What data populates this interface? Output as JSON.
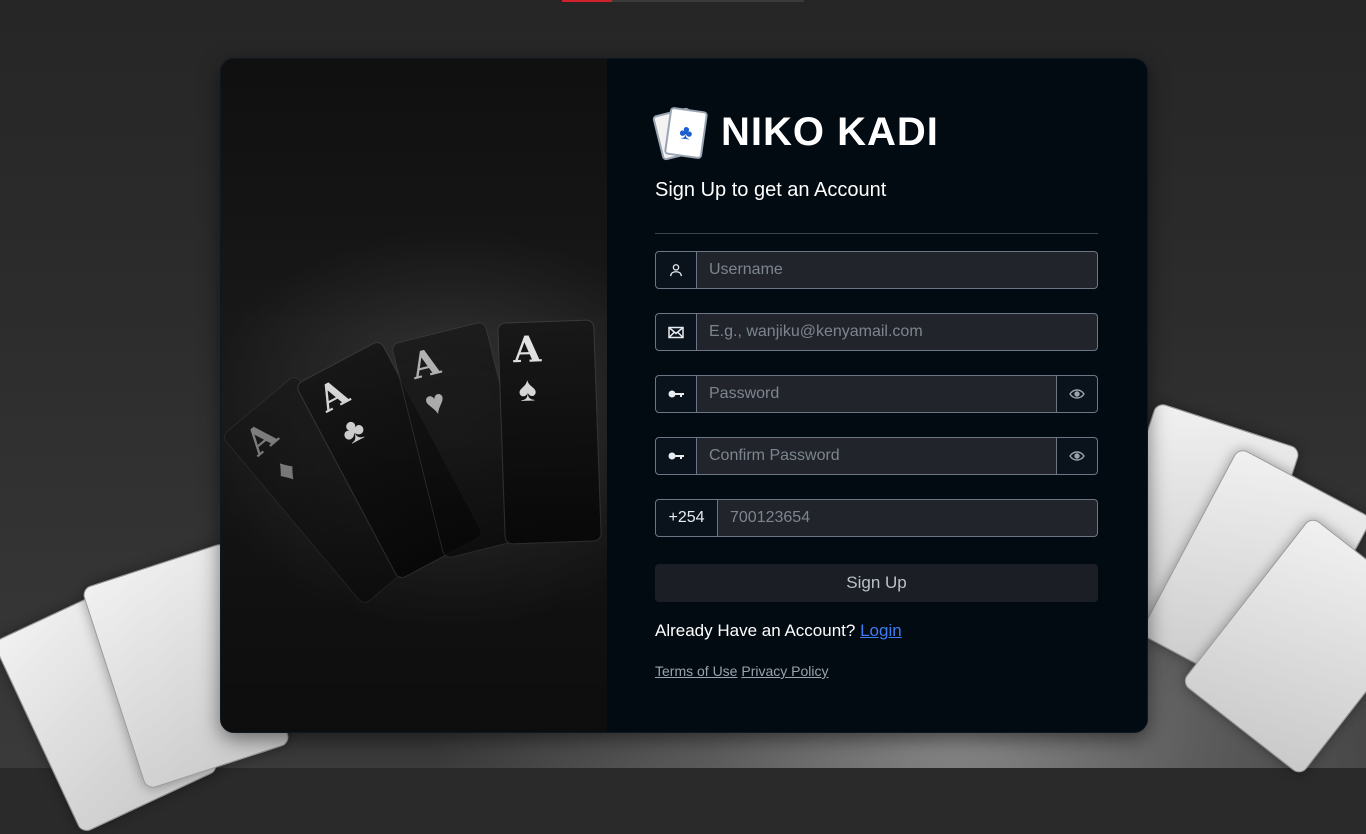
{
  "brand": {
    "title": "NIKO KADI",
    "logo": "playing-cards-logo"
  },
  "form": {
    "subtitle": "Sign Up to get an Account",
    "username": {
      "placeholder": "Username",
      "icon": "user-icon"
    },
    "email": {
      "placeholder": "E.g., wanjiku@kenyamail.com",
      "icon": "envelope-icon"
    },
    "password": {
      "placeholder": "Password",
      "icon": "key-icon",
      "toggle_icon": "eye-icon"
    },
    "confirm_password": {
      "placeholder": "Confirm Password",
      "icon": "key-icon",
      "toggle_icon": "eye-icon"
    },
    "phone": {
      "prefix": "+254",
      "placeholder": "700123654"
    },
    "submit_label": "Sign Up",
    "already_text": "Already Have an Account?",
    "login_link": "Login",
    "terms_link": "Terms of Use",
    "privacy_link": "Privacy Policy"
  },
  "colors": {
    "panel_bg": "#020a12",
    "link": "#3d7cf2",
    "accent_bar": "#d0202a"
  }
}
